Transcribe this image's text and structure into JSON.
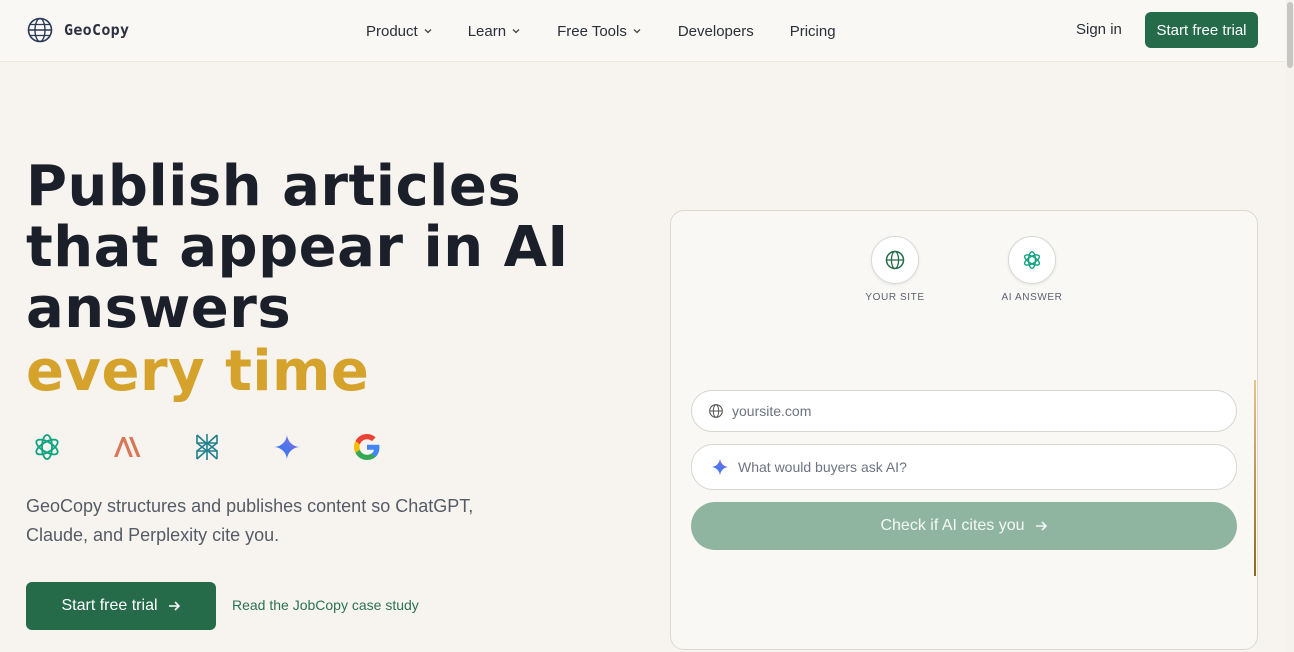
{
  "brand": {
    "name": "GeoCopy",
    "icon": "globe-icon",
    "accent": "#256b4a",
    "highlight": "#d5a22c"
  },
  "nav": {
    "items": [
      {
        "label": "Product",
        "dropdown": true
      },
      {
        "label": "Learn",
        "dropdown": true
      },
      {
        "label": "Free Tools",
        "dropdown": true
      },
      {
        "label": "Developers",
        "dropdown": false
      },
      {
        "label": "Pricing",
        "dropdown": false
      }
    ],
    "sign_in": "Sign in",
    "cta": "Start free trial"
  },
  "hero": {
    "headline_line1": "Publish articles",
    "headline_line2": "that appear in AI",
    "headline_line3": "answers",
    "headline_accent": "every time",
    "ai_logos": [
      "chatgpt-icon",
      "anthropic-icon",
      "perplexity-icon",
      "gemini-icon",
      "google-icon"
    ],
    "subtitle": "GeoCopy structures and publishes content so ChatGPT, Claude, and Perplexity cite you.",
    "cta": "Start free trial",
    "secondary_link": "Read the JobCopy case study"
  },
  "checker": {
    "your_site_label": "YOUR SITE",
    "ai_answer_label": "AI ANSWER",
    "url_placeholder": "yoursite.com",
    "question_placeholder": "What would buyers ask AI?",
    "button": "Check if AI cites you"
  }
}
